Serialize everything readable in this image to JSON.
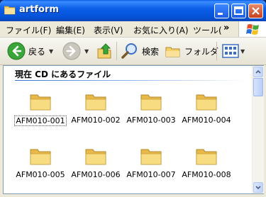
{
  "window": {
    "title": "artform"
  },
  "menu": {
    "items": [
      "ファイル(F)",
      "編集(E)",
      "表示(V)",
      "お気に入り(A)",
      "ツール("
    ],
    "more": "»"
  },
  "toolbar": {
    "back_label": "戻る",
    "search_label": "検索",
    "folders_label": "フォルダ"
  },
  "content": {
    "header": "現在 CD にあるファイル",
    "files": [
      "AFM010-001",
      "AFM010-002",
      "AFM010-003",
      "AFM010-004",
      "AFM010-005",
      "AFM010-006",
      "AFM010-007",
      "AFM010-008"
    ]
  },
  "colors": {
    "titlebar": "#0553d8",
    "folder": "#f4d06a",
    "window_bg": "#ece9d8"
  }
}
